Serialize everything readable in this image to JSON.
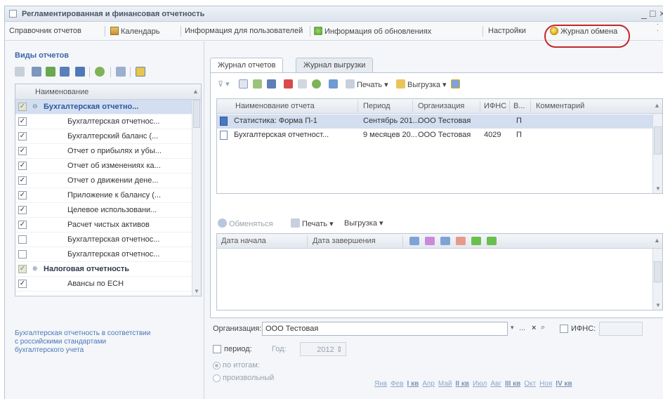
{
  "window": {
    "title": "Регламентированная и финансовая отчетность"
  },
  "menu": {
    "items": [
      "Справочник отчетов",
      "Календарь",
      "Информация для пользователей",
      "Информация об обновлениях",
      "Настройки",
      "Журнал обмена"
    ]
  },
  "left_panel": {
    "title": "Виды отчетов",
    "tree_header": "Наименование",
    "rows": [
      {
        "label": "Бухгалтерская отчетно...",
        "group": true,
        "checked": true
      },
      {
        "label": "Бухгалтерская отчетнос...",
        "checked": true
      },
      {
        "label": "Бухгалтерский баланс (...",
        "checked": true
      },
      {
        "label": "Отчет о прибылях и убы...",
        "checked": true
      },
      {
        "label": "Отчет об изменениях ка...",
        "checked": true
      },
      {
        "label": "Отчет о движении дене...",
        "checked": true
      },
      {
        "label": "Приложение к балансу (...",
        "checked": true
      },
      {
        "label": "Целевое использовани...",
        "checked": true
      },
      {
        "label": "Расчет чистых активов",
        "checked": true
      },
      {
        "label": "Бухгалтерская отчетнос...",
        "checked": false
      },
      {
        "label": "Бухгалтерская отчетнос...",
        "checked": false
      },
      {
        "label": "Налоговая отчетность",
        "group": true,
        "checked": true
      },
      {
        "label": "Авансы по ЕСН",
        "checked": true
      }
    ],
    "description": "Бухгалтерская отчетность в соответствии с российскими стандартами бухгалтерского учета"
  },
  "tabs": [
    "Журнал отчетов",
    "Журнал выгрузки"
  ],
  "toolbar": {
    "print": "Печать",
    "export": "Выгрузка"
  },
  "reports_table": {
    "headers": [
      "Наименование отчета",
      "Период",
      "Организация",
      "ИФНС",
      "В...",
      "Комментарий"
    ],
    "rows": [
      [
        "Статистика: Форма П-1",
        "Сентябрь 201...",
        "ООО Тестовая",
        "",
        "П",
        ""
      ],
      [
        "Бухгалтерская отчетност...",
        "9 месяцев 20...",
        "ООО Тестовая",
        "4029",
        "П",
        ""
      ]
    ]
  },
  "exchange_toolbar": {
    "exchange": "Обменяться",
    "print": "Печать",
    "export": "Выгрузка"
  },
  "exchange_table": {
    "headers": [
      "Дата начала",
      "Дата завершения"
    ]
  },
  "form": {
    "organization_label": "Организация:",
    "organization_value": "ООО Тестовая",
    "ifns_label": "ИФНС:",
    "period_label": "период:",
    "year_label": "Год:",
    "year_value": "2012",
    "radio_totals": "по итогам:",
    "radio_custom": "произвольный",
    "months": [
      "Янв",
      "Фев",
      "I кв",
      "Апр",
      "Май",
      "II кв",
      "Июл",
      "Авг",
      "III кв",
      "Окт",
      "Ноя",
      "IV кв"
    ]
  },
  "colors": {
    "accent": "#3a66a6",
    "highlight_ring": "#c3282b",
    "selection": "#d3dff0"
  }
}
